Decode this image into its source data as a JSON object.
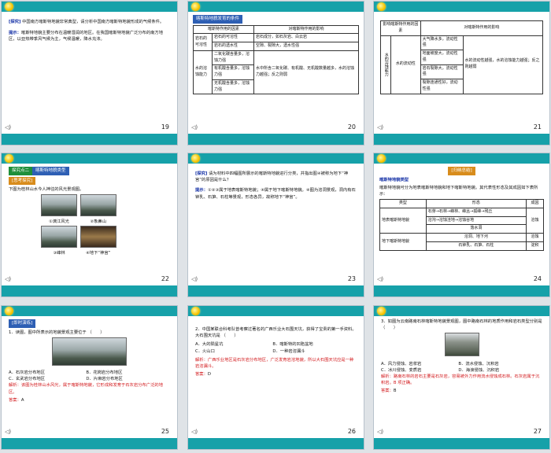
{
  "slides": [
    {
      "number": "19",
      "label": "[探究]",
      "text": "中国南方喀斯特地貌非常典型，请分析中国南方喀斯特地貌形成的气候条件。",
      "hint_label": "提示：",
      "hint": "喀斯特地貌主要分布在温暖湿润的地区。在我国喀斯特地貌广泛分布的南方地区，以亚热带季风气候为主，气候温暖，降水充沛。"
    },
    {
      "number": "20",
      "title": "喀斯特地貌发育的条件",
      "headers": [
        "喀斯特作用的因素",
        "",
        "对喀斯特作用的影响"
      ],
      "g1": "岩石的可溶性",
      "g2": "水的溶蚀能力",
      "rows": [
        [
          "岩石的可溶性",
          "岩石成分，如石灰岩、白云岩",
          "岩石的可溶性越强，溶蚀作用越强"
        ],
        [
          "岩石的透水性",
          "空隙、裂隙大，透水性强",
          ""
        ],
        [
          "水体成分",
          "二氧化碳含量多，溶蚀力强",
          "水中所含二氧化碳、有机酸、无机酸数量越多，水的溶蚀力越强；反之则弱"
        ],
        [
          "",
          "有机酸含量多，溶蚀力强",
          ""
        ],
        [
          "",
          "无机酸含量多，溶蚀力强",
          ""
        ]
      ]
    },
    {
      "number": "21",
      "headers": [
        "影响喀斯特作用的因素",
        "对喀斯特作用的影响"
      ],
      "g": "水的溶蚀能力",
      "sub": "水的流动性",
      "rows": [
        "大气降水多，流动性强",
        "地面坡度大，流动性强",
        "岩石裂隙大，流动性强",
        "裂隙连通性好，流动性强"
      ],
      "effect": "水的流动性越强，水的溶蚀能力越强；反之则越弱"
    },
    {
      "number": "22",
      "tag": "探究点二",
      "tag2": "喀斯特地貌类型",
      "sub_tag": "[思考探究]",
      "text": "下图为桂林山水今人神往的风光景观图。",
      "captions": [
        "①漓江风光",
        "②象鼻山",
        "③峰林",
        "④地下“神宫”"
      ]
    },
    {
      "number": "23",
      "label": "[探究]",
      "text": "请为材料中四幅图所展示的喀斯特地貌进行分类，并指出图④被称为地下“神宫”的原因是什么？",
      "hint_label": "提示：",
      "hint": "①②③属于地表喀斯特地貌；④属于地下喀斯特地貌。④图为溶洞景观，洞内有石钟乳、石笋、石柱等景观，形态各异，故称地下“神宫”。"
    },
    {
      "number": "24",
      "title": "喀斯特地貌类型",
      "tag": "[归纳总结]",
      "text": "喀斯特地貌可分为地表喀斯特地貌和地下喀斯特地貌。其代表性形态及其成因如下表所示：",
      "headers": [
        "类型",
        "形态",
        "成因"
      ],
      "r1": "地表喀斯特地貌",
      "r2": "地下喀斯特地貌",
      "shapes1": [
        "石芽→石林→峰林、峰丛→孤峰→残丘",
        "溶沟→溶蚀洼地→溶蚀谷地",
        "落水洞"
      ],
      "c1": "溶蚀",
      "shapes2": [
        "溶洞、地下河",
        "石钟乳、石笋、石柱"
      ],
      "c2": [
        "溶蚀",
        "淀积"
      ]
    },
    {
      "number": "25",
      "tag": "[即时演练]",
      "q": "1．读图，图中所表示的地貌景观主要位于",
      "paren": "（　　）",
      "opts": [
        "A．石灰岩分布地区",
        "B．花岗岩分布地区",
        "C．玄武岩分布地区",
        "D．片麻岩分布地区"
      ],
      "analysis_label": "解析：",
      "analysis": "该图为桂林山水风光，属于喀斯特地貌，它形成和发育于石灰岩分布广泛的地区。",
      "answer_label": "答案：",
      "answer": "A"
    },
    {
      "number": "26",
      "q": "2．中国某联合科考队曾考察过著名的广西乐业大石围天坑，获得了宝贵的第一手资料。大石围天坑是",
      "paren": "（　　）",
      "opts": [
        "A．大的陨星坑",
        "B．喀斯特的凹陷盆地",
        "C．火山口",
        "D．一种岩溶漏斗"
      ],
      "analysis_label": "解析：",
      "analysis": "广西乐业地区是石灰岩分布地区，广泛发育岩溶地貌，所以大石围天坑应是一种岩溶漏斗。",
      "answer_label": "答案：",
      "answer": "D"
    },
    {
      "number": "27",
      "q": "3．如图为云南路南石林喀斯特地貌景观图，图中路南石林的地质作用和岩石类型分别是",
      "paren": "（　　）",
      "opts": [
        "A．风力侵蚀、岩浆岩",
        "B．流水侵蚀、沉积岩",
        "C．冰川侵蚀、变质岩",
        "D．海浪侵蚀、沉积岩"
      ],
      "analysis_label": "解析：",
      "analysis": "路南石林的岩石主要是石灰岩，容易被外力作用流水侵蚀成石林。石灰岩属于沉积岩。B 项正确。",
      "answer_label": "答案：",
      "answer": "B"
    }
  ],
  "icons": {
    "sound": "speaker-icon",
    "sun": "sun-logo-icon"
  }
}
